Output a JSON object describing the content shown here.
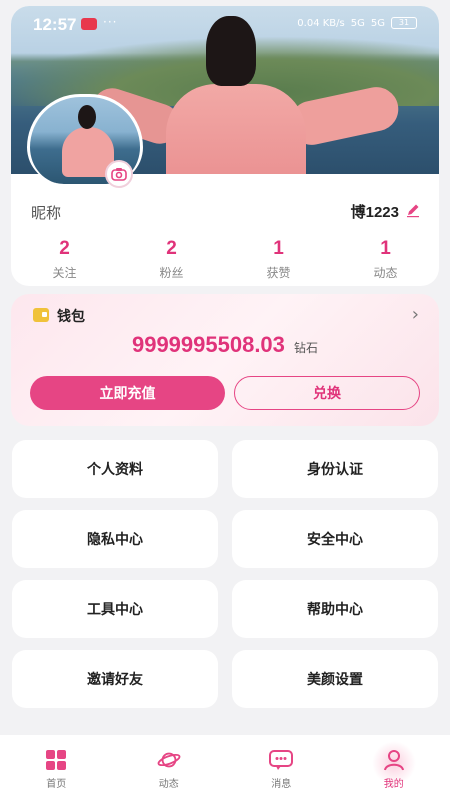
{
  "status_bar": {
    "time": "12:57",
    "dots": "···",
    "net_speed": "0.04 KB/s",
    "signal_a": "5G",
    "signal_b": "5G",
    "battery": "31"
  },
  "profile": {
    "nickname_label": "昵称",
    "nickname_value": "博1223",
    "stats": [
      {
        "value": "2",
        "label": "关注"
      },
      {
        "value": "2",
        "label": "粉丝"
      },
      {
        "value": "1",
        "label": "获赞"
      },
      {
        "value": "1",
        "label": "动态"
      }
    ]
  },
  "wallet": {
    "title": "钱包",
    "balance": "9999995508.03",
    "unit": "钻石",
    "recharge_label": "立即充值",
    "exchange_label": "兑换"
  },
  "menu": [
    {
      "label": "个人资料"
    },
    {
      "label": "身份认证"
    },
    {
      "label": "隐私中心"
    },
    {
      "label": "安全中心"
    },
    {
      "label": "工具中心"
    },
    {
      "label": "帮助中心"
    },
    {
      "label": "邀请好友"
    },
    {
      "label": "美颜设置"
    }
  ],
  "nav": [
    {
      "label": "首页",
      "icon": "grid-icon"
    },
    {
      "label": "动态",
      "icon": "planet-icon"
    },
    {
      "label": "消息",
      "icon": "chat-icon"
    },
    {
      "label": "我的",
      "icon": "user-icon"
    }
  ],
  "colors": {
    "accent": "#e64584",
    "accent_text": "#e0337a",
    "background": "#f2f2f4"
  }
}
